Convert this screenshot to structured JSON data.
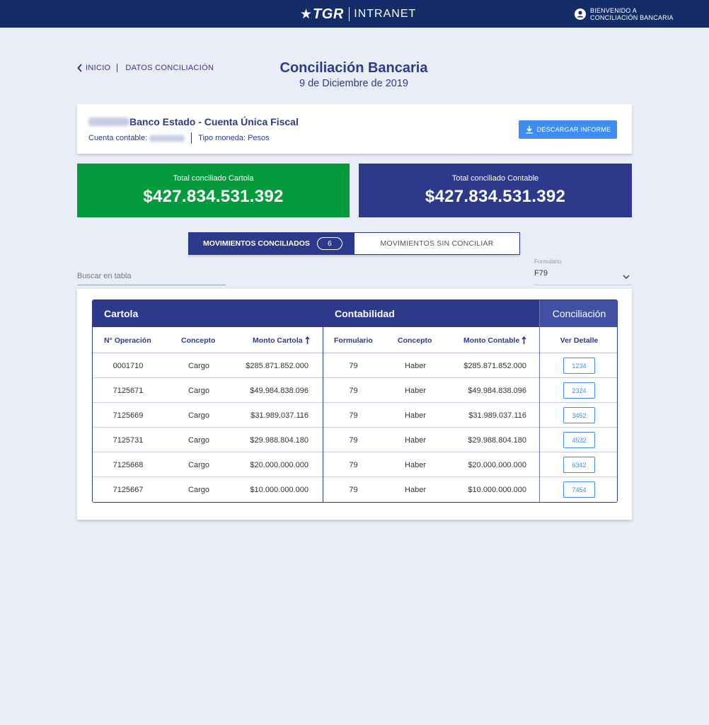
{
  "header": {
    "brand": "TGR",
    "app_name": "INTRANET",
    "user_line1": "BIENVENIDO A",
    "user_line2": "CONCILIACIÓN BANCARIA"
  },
  "breadcrumb": {
    "home": "INICIO",
    "current": "DATOS CONCILIACIÓN"
  },
  "page": {
    "title": "Conciliación Bancaria",
    "date": "9 de Diciembre de 2019"
  },
  "account": {
    "name": "Banco Estado - Cuenta Única Fiscal",
    "accounting_label": "Cuenta contable:",
    "currency_label": "Tipo moneda: Pesos",
    "download_button": "DESCARGAR INFORME"
  },
  "totals": {
    "cartola_label": "Total conciliado Cartola",
    "cartola_value": "$427.834.531.392",
    "contable_label": "Total conciliado Contable",
    "contable_value": "$427.834.531.392"
  },
  "tabs": {
    "active_label": "MOVIMIENTOS CONCILIADOS",
    "active_count": "6",
    "inactive_label": "MOVIMIENTOS SIN CONCILIAR"
  },
  "filters": {
    "search_placeholder": "Buscar en tabla",
    "form_label": "Formulario",
    "form_value": "F79"
  },
  "table": {
    "group_cartola": "Cartola",
    "group_contabilidad": "Contabilidad",
    "group_conciliacion": "Conciliación",
    "col_operacion": "N° Operación",
    "col_concepto": "Concepto",
    "col_monto_cartola": "Monto Cartola",
    "col_formulario": "Formulario",
    "col_concepto2": "Concepto",
    "col_monto_contable": "Monto Contable",
    "col_detalle": "Ver Detalle",
    "rows": [
      {
        "operacion": "0001710",
        "concepto": "Cargo",
        "monto_cartola": "$285.871.852.000",
        "formulario": "79",
        "concepto2": "Haber",
        "monto_contable": "$285.871.852.000",
        "detalle": "1234"
      },
      {
        "operacion": "7125671",
        "concepto": "Cargo",
        "monto_cartola": "$49.984.838.096",
        "formulario": "79",
        "concepto2": "Haber",
        "monto_contable": "$49.984.838.096",
        "detalle": "2324"
      },
      {
        "operacion": "7125669",
        "concepto": "Cargo",
        "monto_cartola": "$31.989.037.116",
        "formulario": "79",
        "concepto2": "Haber",
        "monto_contable": "$31.989.037.116",
        "detalle": "3452"
      },
      {
        "operacion": "7125731",
        "concepto": "Cargo",
        "monto_cartola": "$29.988.804.180",
        "formulario": "79",
        "concepto2": "Haber",
        "monto_contable": "$29.988.804.180",
        "detalle": "4532"
      },
      {
        "operacion": "7125668",
        "concepto": "Cargo",
        "monto_cartola": "$20.000.000.000",
        "formulario": "79",
        "concepto2": "Haber",
        "monto_contable": "$20.000.000.000",
        "detalle": "6342"
      },
      {
        "operacion": "7125667",
        "concepto": "Cargo",
        "monto_cartola": "$10.000.000.000",
        "formulario": "79",
        "concepto2": "Haber",
        "monto_contable": "$10.000.000.000",
        "detalle": "7454"
      }
    ]
  },
  "colors": {
    "navy": "#142d68",
    "primary": "#2d3a8c",
    "green": "#059b3c",
    "accent_blue": "#3f8df2",
    "background": "#e9eef6"
  }
}
